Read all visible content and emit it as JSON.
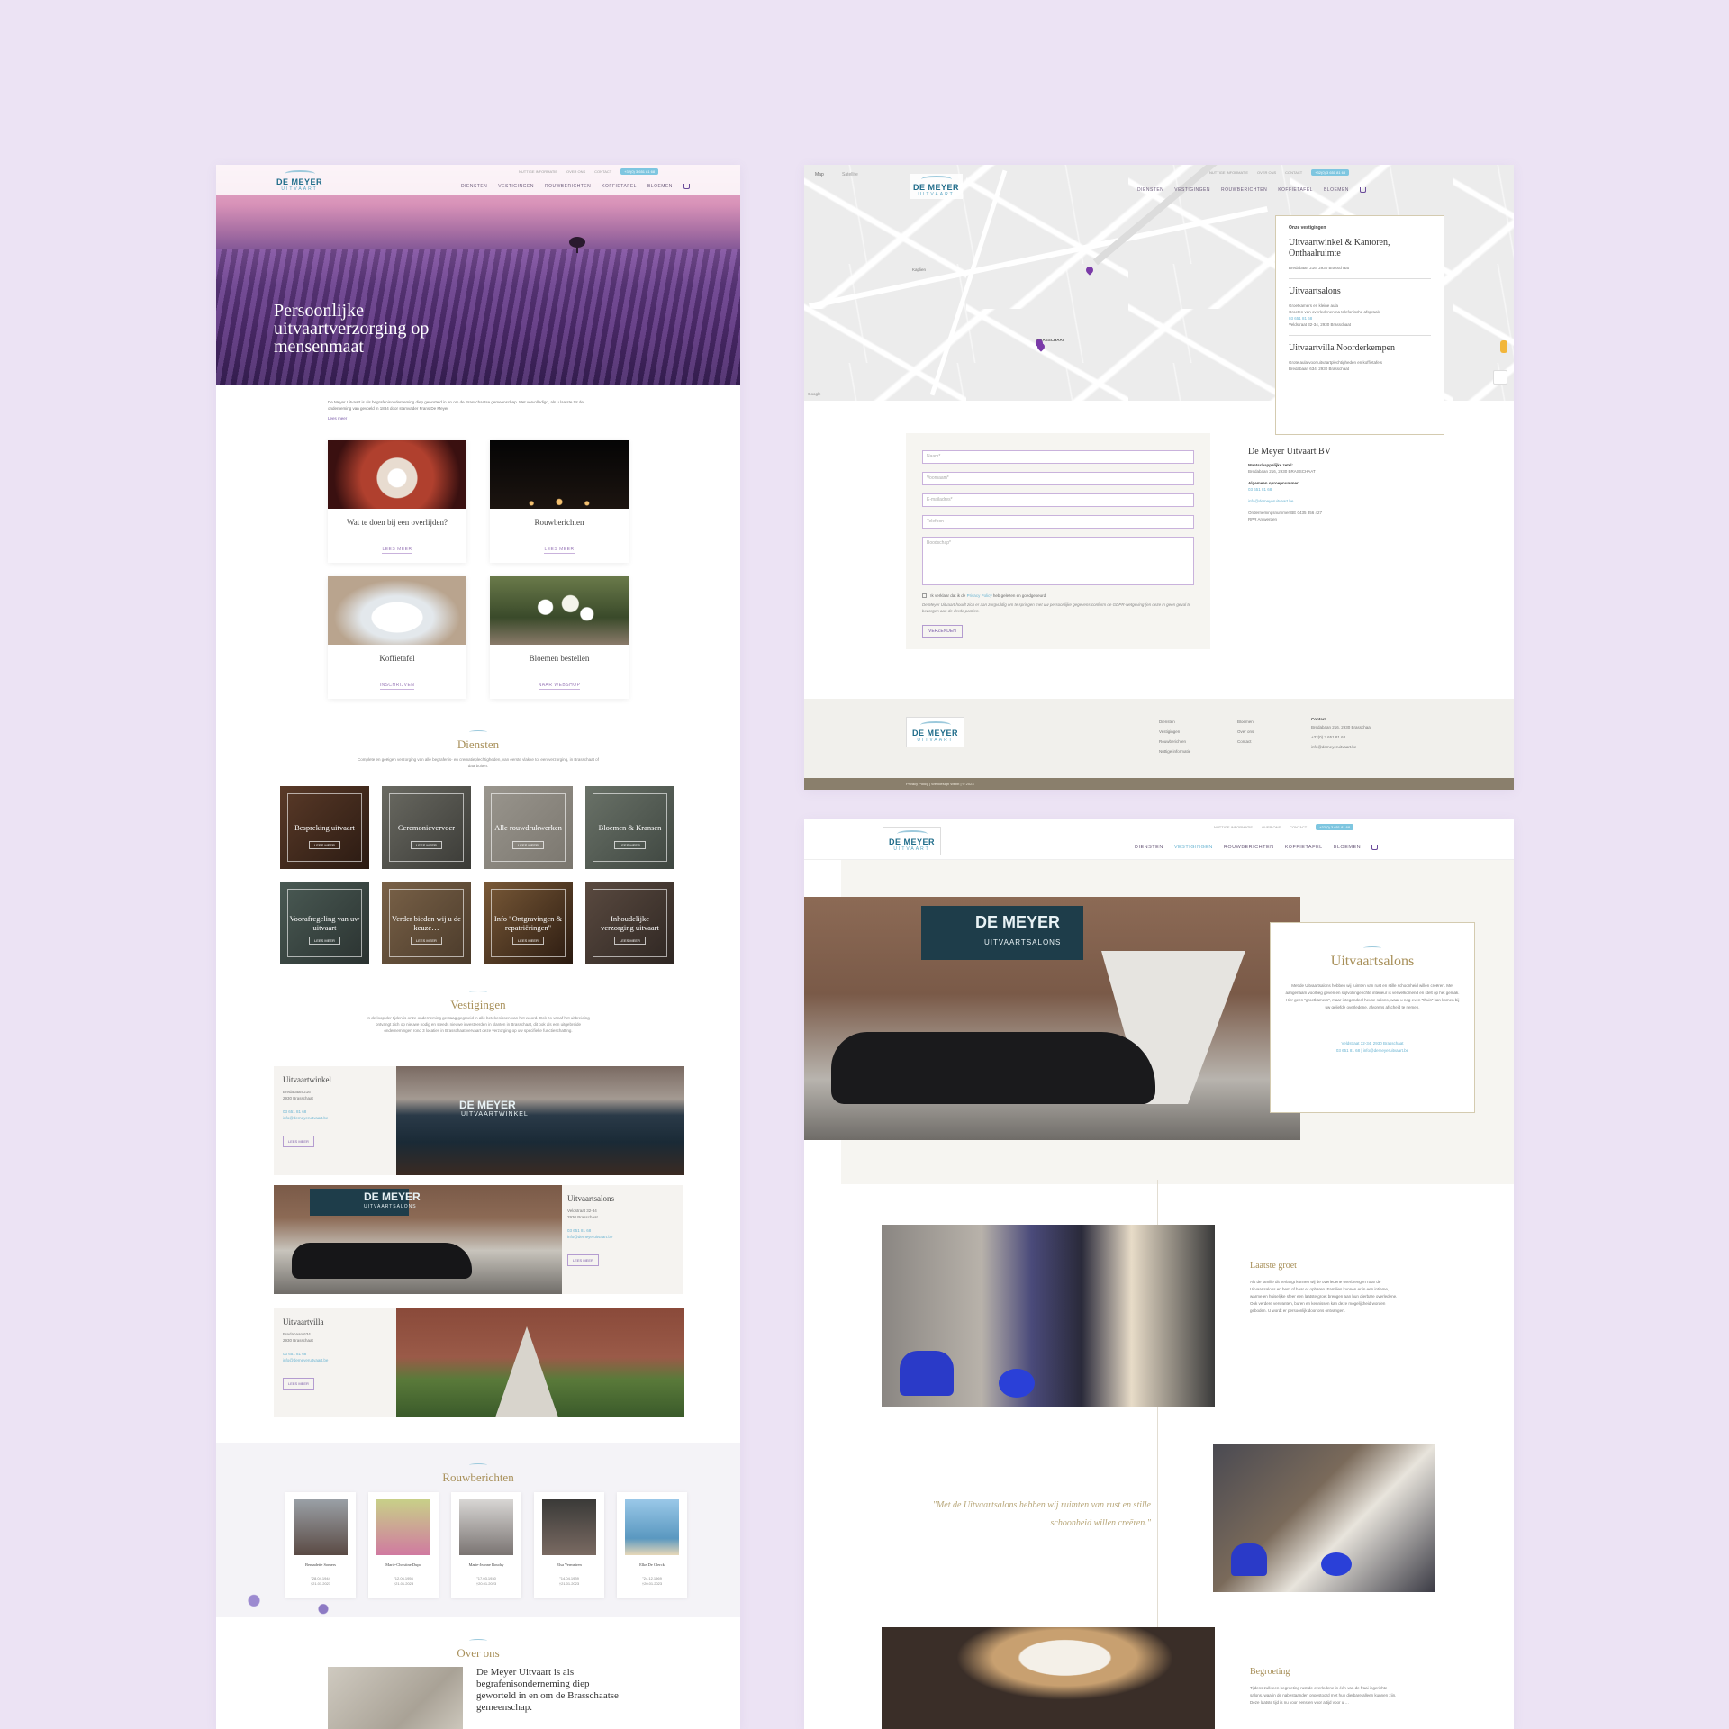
{
  "nav": {
    "logo_line1": "DE MEYER",
    "logo_line2": "UITVAART",
    "util": [
      "NUTTIGE INFORMATIE",
      "OVER ONS",
      "CONTACT"
    ],
    "phone": "+32(0) 3 651 81 68",
    "menu": [
      "DIENSTEN",
      "VESTIGINGEN",
      "ROUWBERICHTEN",
      "KOFFIETAFEL",
      "BLOEMEN"
    ]
  },
  "home": {
    "hero_title": "Persoonlijke uitvaartverzorging op mensenmaat",
    "intro": "De Meyer Uitvaart is als begrafenisonderneming diep geworteld in en om de Brasschaatse gemeenschap. Met vervolledigd, als u laatste tot de onderneming van gevoeld in 1884 door stamvader Frans De Meyer",
    "intro_more": "Lees meer",
    "cards": [
      {
        "title": "Wat te doen bij een overlijden?",
        "link": "LEES MEER"
      },
      {
        "title": "Rouwberichten",
        "link": "LEES MEER"
      },
      {
        "title": "Koffietafel",
        "link": "INSCHRIJVEN"
      },
      {
        "title": "Bloemen bestellen",
        "link": "NAAR WEBSHOP"
      }
    ],
    "diensten_title": "Diensten",
    "diensten_sub": "Complete en geëigen verzorging van alle begrafenis- en crematieplechtigheden, van eerste vlakke tot een verzorging, in Brasschaat of daarbuiten.",
    "tiles": [
      "Bespreking uitvaart",
      "Ceremonievervoer",
      "Alle rouwdrukwerken",
      "Bloemen & Kransen",
      "Voorafregeling van uw uitvaart",
      "Verder bieden wij u de keuze…",
      "Info \"Ontgravingen & repatriëringen\"",
      "Inhoudelijke verzorging uitvaart"
    ],
    "tile_button": "LEES MEER",
    "vestigingen_title": "Vestigingen",
    "vestigingen_sub": "In de loop der tijden is onze onderneming gestaag gegroeid in alle betekenissen van het woord. Ook zo vanaf het uitbreiding ontvangt zich op nieuwe nodig en steeds nieuwe investeerden in klanten in Brasschaat, dit ook als een uitgebreide ondernemingen rond 3 locaties in Brasschaat vervaart deze verzorging op uw specifieke functieschatting.",
    "locations": [
      {
        "title": "Uitvaartwinkel",
        "address1": "Bredabaan 216",
        "address2": "2930 Brasschaat",
        "phone": "03 651 81 68",
        "email": "info@demeyeruitvaart.be",
        "button": "LEES MEER",
        "sign_1": "DE MEYER",
        "sign_2": "UITVAARTWINKEL"
      },
      {
        "title": "Uitvaartsalons",
        "address1": "Veldstraat 32-34",
        "address2": "2930 Brasschaat",
        "phone": "03 651 81 68",
        "email": "info@demeyeruitvaart.be",
        "button": "LEES MEER",
        "sign_1": "DE MEYER",
        "sign_2": "UITVAARTSALONS"
      },
      {
        "title": "Uitvaartvilla",
        "address1": "Bredabaan 634",
        "address2": "2930 Brasschaat",
        "phone": "03 651 81 68",
        "email": "info@demeyeruitvaart.be",
        "button": "LEES MEER"
      }
    ],
    "rouw_title": "Rouwberichten",
    "obituaries": [
      {
        "name": "Bernadette Somers",
        "born": "°28.04.1944",
        "died": "†21.01.2023"
      },
      {
        "name": "Marie-Christine Dupo",
        "born": "°12.06.1956",
        "died": "†21.01.2023"
      },
      {
        "name": "Marie-Jeanne Boudry",
        "born": "°17.03.1930",
        "died": "†20.01.2023"
      },
      {
        "name": "Elsa Vermeiren",
        "born": "°14.04.1939",
        "died": "†21.01.2023"
      },
      {
        "name": "Elke De Clerck",
        "born": "°24.12.1969",
        "died": "†20.01.2023"
      }
    ],
    "over_title": "Over ons",
    "over_text": "De Meyer Uitvaart is als begrafenisonderneming diep geworteld in en om de Brasschaatse gemeenschap."
  },
  "contact": {
    "map_label_1": "Map",
    "map_label_2": "Satellite",
    "map_places": [
      "Kaplien",
      "BRASSCHAAT",
      "Google"
    ],
    "box_caption": "Onze vestigingen",
    "box": [
      {
        "title": "Uitvaartwinkel & Kantoren, Onthaalruimte",
        "lines": [
          "Bredabaan 216, 2930 Brasschaat"
        ]
      },
      {
        "title": "Uitvaartsalons",
        "lines": [
          "Groetkamers en kleine aula",
          "Groeten van overledenen na telefonische afspraak:"
        ],
        "phone": "03 651 81 68",
        "extra": "Veldstraat 32-34, 2930 Brasschaat"
      },
      {
        "title": "Uitvaartvilla Noorderkempen",
        "lines": [
          "Grote aula voor uitvaartplechtigheden en koffietafels",
          "Bredabaan 634, 2930 Brasschaat"
        ]
      }
    ],
    "fields": [
      "Naam*",
      "Voornaam*",
      "E-mailadres*",
      "Telefoon",
      "Boodschap*"
    ],
    "consent_pre": "Ik verklaar dat ik de",
    "consent_link": "Privacy Policy",
    "consent_post": "heb gelezen en goedgekeurd.",
    "note": "De Meyer Uitvaart houdt zich er aan zorgvuldig om te springen met uw persoonlijke gegevens conform de GDPR-wetgeving (en deze in geen geval te bezorgen aan de derde partijen.",
    "send": "VERZENDEN",
    "company": "De Meyer Uitvaart BV",
    "seat_label": "Maatschappelijke zetel:",
    "seat": "Bredabaan 216, 2930 BRASSCHAAT",
    "general_label": "Algemeen oproepnummer",
    "general_phone": "03 651 81 68",
    "email": "info@demeyeruitvaart.be",
    "vat": "Ondernemingsnummer BE 0435 356 427",
    "rpr": "RPR Antwerpen",
    "footer_col1": [
      "Diensten",
      "Vestigingen",
      "Rouwberichten",
      "Nuttige informatie"
    ],
    "footer_col2": [
      "Bloemen",
      "Over ons",
      "Contact"
    ],
    "footer_contact_title": "Contact",
    "footer_contact": [
      "Bredabaan 216, 2930 Brasschaat",
      "+32(0) 3 651 81 68",
      "info@demeyeruitvaart.be"
    ],
    "bottom_bar": "Privacy Policy  |  Webdesign Webit  |  © 2023"
  },
  "salons": {
    "sign_1": "DE MEYER",
    "sign_2": "UITVAARTSALONS",
    "title": "Uitvaartsalons",
    "text": "Met de Uitvaartsalons hebben wij ruimten van rust en stille schoonheid willen creëren. Met aangenaam voorbeg geven en stijlvol ingerichte interieur is verwelkomend en stelt op het gemak. Hier geen \"groetkamers\", maar integendeel heuse salons, waar u nog even \"thuis\" kan komen bij uw geliefde overledene, alvorens afscheid te nemen.",
    "address": "Veldstraat 32-34, 2930 Brasschaat",
    "contact": "03 651 81 68 | info@demeyeruitvaart.be",
    "laatste_title": "Laatste groet",
    "laatste_text": "Als de familie dit verlangt kunnen wij de overledene overbrengen naar de Uitvaartsalons en hem of haar er opbaren. Families kunnen er in een intieme, warme en huiselijke sfeer een laatste groet brengen aan hun dierbare overledene. Ook verdere verwanten, buren en kennissen kan deze mogelijkheid worden geboden. U wordt er persoonlijk door ons ontvangen.",
    "quote": "\"Met de Uitvaartsalons hebben wij ruimten van rust en stille schoonheid willen creëren.\"",
    "begroeting_title": "Begroeting",
    "begroeting_text": "Tijdens zulk een begroeting rust de overledene in één van de fraai ingerichte salons, waarin de nabestaanden ongestoord met hun dierbare alleen kunnen zijn. Deze laatste tijd is nu voor eens en voor altijd voor u …"
  },
  "colors": {
    "background": "#ece3f4",
    "accent_purple": "#7a5aa8",
    "accent_gold": "#a8905a",
    "accent_blue": "#6ab4d2"
  }
}
